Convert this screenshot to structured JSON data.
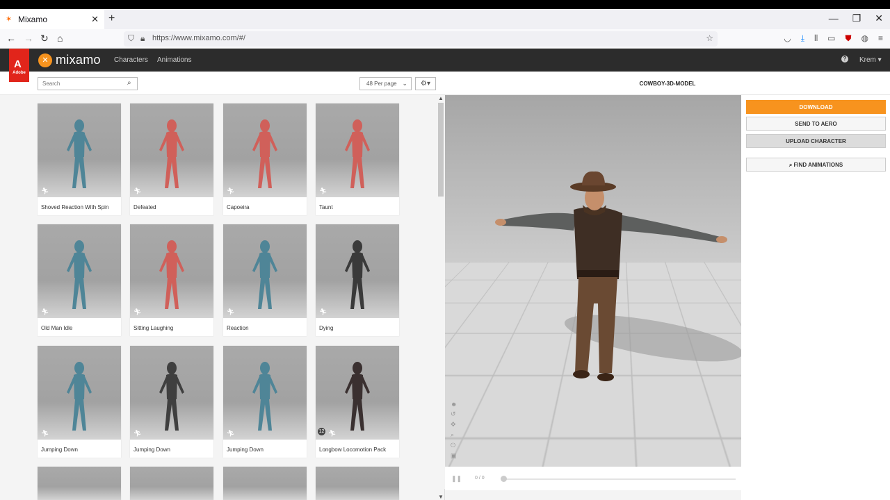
{
  "browser": {
    "tab_title": "Mixamo",
    "url": "https://www.mixamo.com/#/",
    "new_tab": "+",
    "tab_close": "✕"
  },
  "header": {
    "logo_text": "mixamo",
    "adobe_text": "Adobe",
    "nav": [
      "Characters",
      "Animations"
    ],
    "help": "?",
    "user": "Krem ▾"
  },
  "toolbar": {
    "search_placeholder": "Search",
    "per_page": "48 Per page"
  },
  "animations": [
    {
      "name": "Shoved Reaction With Spin",
      "color": "#4f8597"
    },
    {
      "name": "Defeated",
      "color": "#d0605a"
    },
    {
      "name": "Capoeira",
      "color": "#d0605a"
    },
    {
      "name": "Taunt",
      "color": "#d0605a"
    },
    {
      "name": "Old Man Idle",
      "color": "#4f8597"
    },
    {
      "name": "Sitting Laughing",
      "color": "#d0605a"
    },
    {
      "name": "Reaction",
      "color": "#4f8597"
    },
    {
      "name": "Dying",
      "color": "#3a3a3a"
    },
    {
      "name": "Jumping Down",
      "color": "#4f8597"
    },
    {
      "name": "Jumping Down",
      "color": "#3f3f3f"
    },
    {
      "name": "Jumping Down",
      "color": "#4f8597"
    },
    {
      "name": "Longbow Locomotion Pack",
      "color": "#3a3030",
      "pack_count": "12"
    }
  ],
  "viewer": {
    "title": "COWBOY-3D-MODEL",
    "time": "0 / 0"
  },
  "side": {
    "download": "DOWNLOAD",
    "send": "SEND TO AERO",
    "upload": "UPLOAD CHARACTER",
    "find": "FIND ANIMATIONS"
  }
}
